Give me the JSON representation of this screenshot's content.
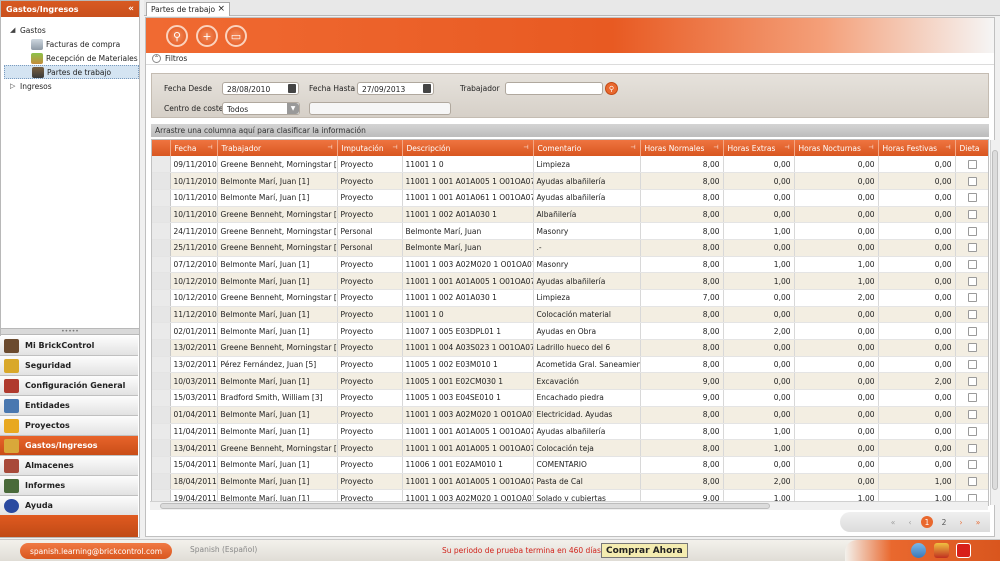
{
  "sidebar": {
    "title": "Gastos/Ingresos",
    "collapse_icon": "double-chevron-left-icon",
    "tree": [
      {
        "label": "Gastos",
        "level": 0,
        "expanded": true
      },
      {
        "label": "Facturas de compra",
        "level": 1,
        "icon": "cart-icon"
      },
      {
        "label": "Recepción de Materiales",
        "level": 1,
        "icon": "truck-icon"
      },
      {
        "label": "Partes de trabajo",
        "level": 1,
        "icon": "document-icon",
        "selected": true
      },
      {
        "label": "Ingresos",
        "level": 0,
        "expanded": false
      }
    ],
    "nav": [
      {
        "label": "Mi BrickControl",
        "icon": "house-icon",
        "color": "#6b4a2e"
      },
      {
        "label": "Seguridad",
        "icon": "lock-icon",
        "color": "#d9a82a"
      },
      {
        "label": "Configuración General",
        "icon": "tools-icon",
        "color": "#b03a2e"
      },
      {
        "label": "Entidades",
        "icon": "org-chart-icon",
        "color": "#4a78b0"
      },
      {
        "label": "Proyectos",
        "icon": "helmet-icon",
        "color": "#e8a820"
      },
      {
        "label": "Gastos/Ingresos",
        "icon": "money-icon",
        "color": "#d9a83a",
        "active": true
      },
      {
        "label": "Almacenes",
        "icon": "boxes-icon",
        "color": "#a84a3a"
      },
      {
        "label": "Informes",
        "icon": "report-icon",
        "color": "#4a6a3a"
      },
      {
        "label": "Ayuda",
        "icon": "help-icon",
        "color": "#2a4aa0"
      }
    ]
  },
  "tab": {
    "label": "Partes de trabajo",
    "close": "×"
  },
  "toolbar": {
    "buttons": [
      "search-icon",
      "add-icon",
      "export-icon"
    ]
  },
  "filters": {
    "section_label": "Filtros",
    "fecha_desde_label": "Fecha Desde",
    "fecha_desde": "28/08/2010",
    "fecha_hasta_label": "Fecha Hasta",
    "fecha_hasta": "27/09/2013",
    "trabajador_label": "Trabajador",
    "trabajador": "",
    "centro_label": "Centro de coste",
    "centro": "Todos",
    "centro_extra": ""
  },
  "group_hint": "Arrastre una columna aquí para clasificar la información",
  "columns": [
    "Fecha",
    "Trabajador",
    "Imputación",
    "Descripción",
    "Comentario",
    "Horas Normales",
    "Horas Extras",
    "Horas Nocturnas",
    "Horas Festivas",
    "Dieta"
  ],
  "rows": [
    [
      "09/11/2010",
      "Greene Benneht, Morningstar [2]",
      "Proyecto",
      "11001 1      0",
      "Limpieza",
      "8,00",
      "0,00",
      "0,00",
      "0,00"
    ],
    [
      "10/11/2010",
      "Belmonte Marí, Juan [1]",
      "Proyecto",
      "11001 1 001 A01A005 1 O01OA070",
      "Ayudas albañilería",
      "8,00",
      "0,00",
      "0,00",
      "0,00"
    ],
    [
      "10/11/2010",
      "Belmonte Marí, Juan [1]",
      "Proyecto",
      "11001 1 001 A01A061 1 O01OA070",
      "Ayudas albañilería",
      "8,00",
      "0,00",
      "0,00",
      "0,00"
    ],
    [
      "10/11/2010",
      "Greene Benneht, Morningstar [2]",
      "Proyecto",
      "11001 1 002 A01A030 1",
      "Albañilería",
      "8,00",
      "0,00",
      "0,00",
      "0,00"
    ],
    [
      "24/11/2010",
      "Greene Benneht, Morningstar [2]",
      "Personal",
      "Belmonte Marí, Juan",
      "Masonry",
      "8,00",
      "1,00",
      "0,00",
      "0,00"
    ],
    [
      "25/11/2010",
      "Greene Benneht, Morningstar [2]",
      "Personal",
      "Belmonte Marí, Juan",
      ".-",
      "8,00",
      "0,00",
      "0,00",
      "0,00"
    ],
    [
      "07/12/2010",
      "Belmonte Marí, Juan [1]",
      "Proyecto",
      "11001 1 003 A02M020 1 O01OA070",
      "Masonry",
      "8,00",
      "1,00",
      "1,00",
      "0,00"
    ],
    [
      "10/12/2010",
      "Belmonte Marí, Juan [1]",
      "Proyecto",
      "11001 1 001 A01A005 1 O01OA070",
      "Ayudas albañilería",
      "8,00",
      "1,00",
      "1,00",
      "0,00"
    ],
    [
      "10/12/2010",
      "Greene Benneht, Morningstar [2]",
      "Proyecto",
      "11001 1 002 A01A030 1",
      "Limpieza",
      "7,00",
      "0,00",
      "2,00",
      "0,00"
    ],
    [
      "11/12/2010",
      "Belmonte Marí, Juan [1]",
      "Proyecto",
      "11001 1      0",
      "Colocación material",
      "8,00",
      "0,00",
      "0,00",
      "0,00"
    ],
    [
      "02/01/2011",
      "Belmonte Marí, Juan [1]",
      "Proyecto",
      "11007 1 005 E03DPL01 1",
      "Ayudas en Obra",
      "8,00",
      "2,00",
      "0,00",
      "0,00"
    ],
    [
      "13/02/2011",
      "Greene Benneht, Morningstar [2]",
      "Proyecto",
      "11001 1 004 A03S023 1 O01OA070",
      "Ladrillo hueco del 6",
      "8,00",
      "0,00",
      "0,00",
      "0,00"
    ],
    [
      "13/02/2011",
      "Pérez Fernández, Juan [5]",
      "Proyecto",
      "11005 1 002 E03M010 1",
      "Acometida Gral. Saneamiento",
      "8,00",
      "0,00",
      "0,00",
      "0,00"
    ],
    [
      "10/03/2011",
      "Belmonte Marí, Juan [1]",
      "Proyecto",
      "11005 1 001 E02CM030 1",
      "Excavación",
      "9,00",
      "0,00",
      "0,00",
      "2,00"
    ],
    [
      "15/03/2011",
      "Bradford Smith, William [3]",
      "Proyecto",
      "11005 1 003 E04SE010 1",
      "Encachado piedra",
      "9,00",
      "0,00",
      "0,00",
      "0,00"
    ],
    [
      "01/04/2011",
      "Belmonte Marí, Juan [1]",
      "Proyecto",
      "11001 1 003 A02M020 1 O01OA070",
      "Electricidad. Ayudas",
      "8,00",
      "0,00",
      "0,00",
      "0,00"
    ],
    [
      "11/04/2011",
      "Belmonte Marí, Juan [1]",
      "Proyecto",
      "11001 1 001 A01A005 1 O01OA070",
      "Ayudas albañilería",
      "8,00",
      "1,00",
      "0,00",
      "0,00"
    ],
    [
      "13/04/2011",
      "Greene Benneht, Morningstar [2]",
      "Proyecto",
      "11001 1 001 A01A005 1 O01OA070",
      "Colocación teja",
      "8,00",
      "1,00",
      "0,00",
      "0,00"
    ],
    [
      "15/04/2011",
      "Belmonte Marí, Juan [1]",
      "Proyecto",
      "11006 1 001 E02AM010 1",
      "COMENTARIO",
      "8,00",
      "0,00",
      "0,00",
      "0,00"
    ],
    [
      "18/04/2011",
      "Belmonte Marí, Juan [1]",
      "Proyecto",
      "11001 1 001 A01A005 1 O01OA070",
      "Pasta de Cal",
      "8,00",
      "2,00",
      "0,00",
      "1,00"
    ],
    [
      "19/04/2011",
      "Belmonte Marí, Juan [1]",
      "Proyecto",
      "11001 1 003 A02M020 1 O01OA070",
      "Solado y cubiertas",
      "9,00",
      "1,00",
      "1,00",
      "1,00"
    ]
  ],
  "pager": {
    "pages": [
      "1",
      "2"
    ],
    "current": "1"
  },
  "status": {
    "user": "spanish.learning@brickcontrol.com",
    "language": "Spanish (Español)",
    "trial": "Su periodo de prueba termina en 460 días",
    "buy": "Comprar Ahora",
    "icons": [
      "user-icon",
      "tools-icon",
      "power-icon"
    ]
  }
}
